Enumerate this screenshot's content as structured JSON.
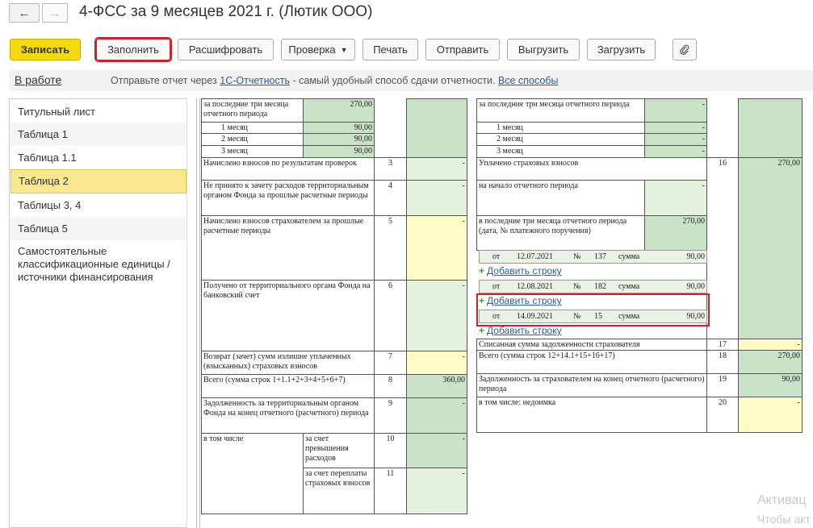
{
  "window": {
    "title": "4-ФСС за 9 месяцев 2021 г. (Лютик ООО)",
    "back_icon": "arrow-left-icon",
    "forward_icon": "arrow-right-icon"
  },
  "toolbar": {
    "save": "Записать",
    "fill": "Заполнить",
    "decode": "Расшифровать",
    "check": "Проверка",
    "print": "Печать",
    "send": "Отправить",
    "export": "Выгрузить",
    "import": "Загрузить",
    "attach_icon": "paperclip-icon"
  },
  "status": {
    "state": "В работе",
    "msg_before": "Отправьте отчет через ",
    "msg_link": "1С-Отчетность",
    "msg_after": " - самый удобный способ сдачи отчетности. ",
    "all_ways": "Все способы"
  },
  "sidebar": {
    "items": [
      "Титульный лист",
      "Таблица 1",
      "Таблица 1.1",
      "Таблица 2",
      "Таблицы 3, 4",
      "Таблица 5",
      "Самостоятельные классификационные единицы / источники финансирования"
    ],
    "active_index": 3
  },
  "left_table": {
    "last_three_months": "за последние три месяца отчетного периода",
    "last_three_months_value": "270,00",
    "month1": "1 месяц",
    "month1_value": "90,00",
    "month2": "2 месяц",
    "month2_value": "90,00",
    "month3": "3 месяц",
    "month3_value": "90,00",
    "r3_label": "Начислено взносов по результатам проверок",
    "r3_num": "3",
    "r3_value": "-",
    "r4_label": "Не принято к зачету расходов территориальным органом Фонда за прошлые расчетные периоды",
    "r4_num": "4",
    "r4_value": "-",
    "r5_label": "Начислено взносов страхователем за прошлые расчетные периоды",
    "r5_num": "5",
    "r5_value": "-",
    "r6_label": "Получено от территориального органа Фонда на банковский счет",
    "r6_num": "6",
    "r6_value": "-",
    "r7_label": "Возврат (зачет) сумм излишне уплаченных (взысканных) страховых взносов",
    "r7_num": "7",
    "r7_value": "-",
    "r8_label": "Всего (сумма строк 1+1.1+2+3+4+5+6+7)",
    "r8_num": "8",
    "r8_value": "360,00",
    "r9_label": "Задолженность за территориальным органом Фонда на конец отчетного (расчетного) периода",
    "r9_num": "9",
    "r9_value": "-",
    "incl": "в том числе",
    "r10_label": "за счет превышения расходов",
    "r10_num": "10",
    "r10_value": "-",
    "r11_label": "за счет переплаты страховых взносов",
    "r11_num": "11",
    "r11_value": "-"
  },
  "right_table": {
    "last_three_months": "за последние три месяца отчетного периода",
    "last_three_months_value": "-",
    "month1": "1 месяц",
    "month1_value": "-",
    "month2": "2 месяц",
    "month2_value": "-",
    "month3": "3 месяц",
    "month3_value": "-",
    "r16_label": "Уплачено страховых взносов",
    "r16_num": "16",
    "r16_value": "270,00",
    "start_period": "на начало отчетного периода",
    "start_period_value": "-",
    "last3_paid": "в последние три месяца отчетного периода",
    "last3_paid_sub": "(дата, № платежного поручения)",
    "last3_paid_value": "270,00",
    "payments": [
      {
        "from": "от",
        "date": "12.07.2021",
        "no_label": "№",
        "no": "137",
        "sum_label": "сумма",
        "sum": "90,00"
      },
      {
        "from": "от",
        "date": "12.08.2021",
        "no_label": "№",
        "no": "182",
        "sum_label": "сумма",
        "sum": "90,00"
      },
      {
        "from": "от",
        "date": "14.09.2021",
        "no_label": "№",
        "no": "15",
        "sum_label": "сумма",
        "sum": "90,00"
      }
    ],
    "add_row": "Добавить строку",
    "r17_label": "Списанная сумма задолженности страхователя",
    "r17_num": "17",
    "r17_value": "-",
    "r18_label": "Всего (сумма строк 12+14.1+15+16+17)",
    "r18_num": "18",
    "r18_value": "270,00",
    "r19_label": "Задолженность за страхователем на конец отчетного (расчетного) периода",
    "r19_num": "19",
    "r19_value": "90,00",
    "r20_label": "в том числе: недоимка",
    "r20_num": "20",
    "r20_value": "-"
  },
  "watermark": {
    "line1": "Активац",
    "line2": "Чтобы акт"
  }
}
